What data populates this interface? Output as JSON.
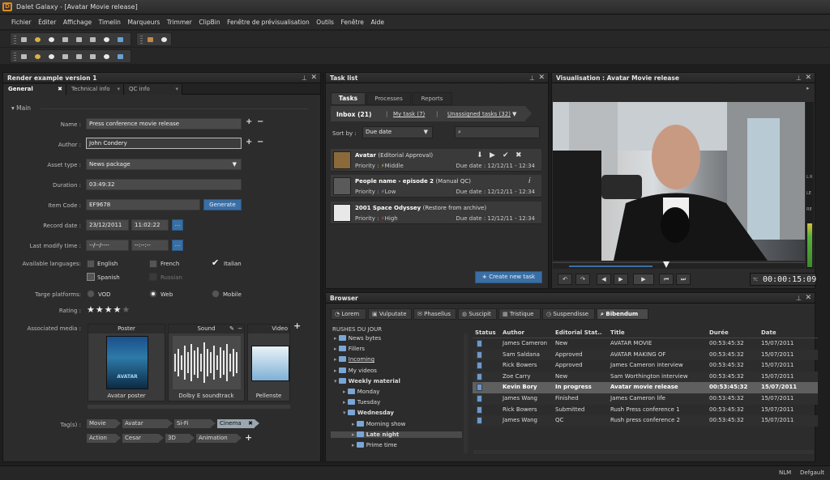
{
  "window": {
    "title": "Dalet Galaxy - [Avatar Movie release]"
  },
  "menu": [
    "Fichier",
    "Éditer",
    "Affichage",
    "Timelin",
    "Marqueurs",
    "Trimmer",
    "ClipBin",
    "Fenêtre de prévisualisation",
    "Outils",
    "Fenêtre",
    "Aide"
  ],
  "render_panel": {
    "title": "Render example version 1",
    "tabs": [
      "General",
      "Technical info",
      "QC info"
    ],
    "section": "Main",
    "labels": {
      "name": "Name :",
      "author": "Author :",
      "asset_type": "Asset type :",
      "duration": "Duration :",
      "item_code": "Item Code :",
      "record_date": "Record date :",
      "last_modify": "Last modify time :",
      "languages": "Available languages:",
      "platforms": "Targe platforms:",
      "rating": "Rating :",
      "media": "Associated media :",
      "tags": "Tag(s) :"
    },
    "values": {
      "name": "Press conference movie release",
      "author": "John Condery",
      "asset_type": "News package",
      "duration": "03:49:32",
      "item_code": "EF9678",
      "record_date": "23/12/2011",
      "record_time": "11:02:22",
      "modify_date": "--/--/----",
      "modify_time": "--:--:--"
    },
    "generate_label": "Generate",
    "calendar_label": "...",
    "languages": [
      {
        "label": "English",
        "checked": false,
        "enabled": true
      },
      {
        "label": "French",
        "checked": false,
        "enabled": true
      },
      {
        "label": "Italian",
        "checked": true,
        "enabled": true
      },
      {
        "label": "Spanish",
        "checked": false,
        "enabled": true
      },
      {
        "label": "Russian",
        "checked": false,
        "enabled": false
      }
    ],
    "platforms": [
      {
        "label": "VOD",
        "selected": false
      },
      {
        "label": "Web",
        "selected": true
      },
      {
        "label": "Mobile",
        "selected": false
      }
    ],
    "rating": {
      "value": 4,
      "max": 5
    },
    "media": [
      {
        "header": "Poster",
        "caption": "Avatar poster",
        "poster_text": "AVATAR"
      },
      {
        "header": "Sound",
        "caption": "Dolby E soundtrack"
      },
      {
        "header": "Video",
        "caption": "Pellenste"
      }
    ],
    "tags": [
      "Movie",
      "Avatar",
      "Si-Fi",
      "Cinema",
      "Action",
      "Cesar",
      "3D",
      "Animation"
    ]
  },
  "task_panel": {
    "title": "Task list",
    "tabs": [
      "Tasks",
      "Processes",
      "Reports"
    ],
    "filters": [
      "Inbox (21)",
      "My task (7)",
      "Unassigned tasks (32)"
    ],
    "sort_label": "Sort by :",
    "sort_value": "Due date",
    "tasks": [
      {
        "name": "Avatar",
        "type": "(Editorial Approval)",
        "priority": "Middle",
        "due": "Due date : 12/12/11 - 12:34"
      },
      {
        "name": "People name - episode 2",
        "type": "(Manual QC)",
        "priority": "Low",
        "due": "Due date : 12/12/11 - 12:34"
      },
      {
        "name": "2001 Space Odyssey",
        "type": "(Restore from archive)",
        "priority": "High",
        "due": "Due date : 12/12/11 - 12:34"
      }
    ],
    "priority_label": "Priority :",
    "create_label": "Create new task"
  },
  "viewer": {
    "title": "Visualisation : Avatar Movie release",
    "timecode_label": "TC",
    "timecode": "00:00:15:09",
    "meter_labels": [
      "L",
      "R",
      "LE",
      "RE"
    ],
    "progress": 0.33
  },
  "browser": {
    "title": "Browser",
    "tabs": [
      "Lorem",
      "Vulputate",
      "Phasellus",
      "Suscipit",
      "Tristique",
      "Suspendisse",
      "Bibendum"
    ],
    "tree_root": "RUSHES DU JOUR",
    "tree": [
      {
        "label": "News bytes",
        "level": 0,
        "bold": false
      },
      {
        "label": "Fillers",
        "level": 0,
        "bold": false
      },
      {
        "label": "Incoming",
        "level": 0,
        "bold": false,
        "underline": true
      },
      {
        "label": "My videos",
        "level": 0,
        "bold": false
      },
      {
        "label": "Weekly material",
        "level": 0,
        "bold": true
      },
      {
        "label": "Monday",
        "level": 1,
        "bold": false
      },
      {
        "label": "Tuesday",
        "level": 1,
        "bold": false
      },
      {
        "label": "Wednesday",
        "level": 1,
        "bold": true
      },
      {
        "label": "Morning show",
        "level": 2,
        "bold": false
      },
      {
        "label": "Late night",
        "level": 2,
        "bold": true,
        "selected": true
      },
      {
        "label": "Prime time",
        "level": 2,
        "bold": false
      }
    ],
    "columns": [
      "Status",
      "Author",
      "Editorial Stat..",
      "Title",
      "Durée",
      "Date"
    ],
    "rows": [
      [
        "James Cameron",
        "New",
        "AVATAR MOVIE",
        "00:53:45:32",
        "15/07/2011"
      ],
      [
        "Sam Saldana",
        "Approved",
        "AVATAR MAKING OF",
        "00:53:45:32",
        "15/07/2011"
      ],
      [
        "Rick Bowers",
        "Approved",
        "James Cameron interview",
        "00:53:45:32",
        "15/07/2011"
      ],
      [
        "Zoe Carry",
        "New",
        "Sam Worthington interview",
        "00:53:45:32",
        "15/07/2011"
      ],
      [
        "Kevin Bory",
        "In progress",
        "Avatar movie release",
        "00:53:45:32",
        "15/07/2011"
      ],
      [
        "James Wang",
        "Finished",
        "James Cameron life",
        "00:53:45:32",
        "15/07/2011"
      ],
      [
        "Rick Bowers",
        "Submitted",
        "Rush Press conference 1",
        "00:53:45:32",
        "15/07/2011"
      ],
      [
        "James Wang",
        "QC",
        "Rush press conference 2",
        "00:53:45:32",
        "15/07/2011"
      ]
    ],
    "selected_row": 4
  },
  "status_bar": [
    "NLM",
    "Defgault"
  ]
}
